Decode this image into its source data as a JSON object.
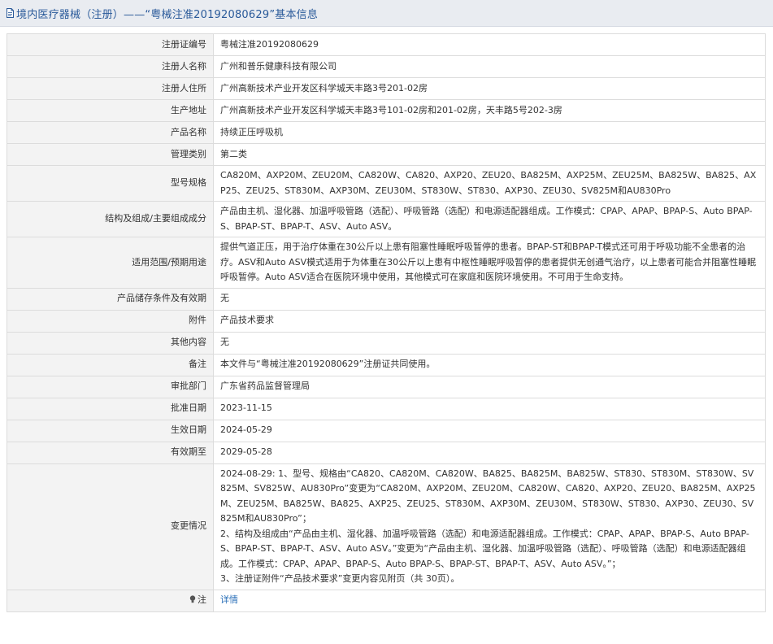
{
  "page": {
    "title": "境内医疗器械（注册）——“粤械注准20192080629”基本信息",
    "title_icon": "document-icon"
  },
  "rows": [
    {
      "label": "注册证编号",
      "value": "粤械注准20192080629"
    },
    {
      "label": "注册人名称",
      "value": "广州和普乐健康科技有限公司"
    },
    {
      "label": "注册人住所",
      "value": "广州高新技术产业开发区科学城天丰路3号201-02房"
    },
    {
      "label": "生产地址",
      "value": "广州高新技术产业开发区科学城天丰路3号101-02房和201-02房，天丰路5号202-3房"
    },
    {
      "label": "产品名称",
      "value": "持续正压呼吸机"
    },
    {
      "label": "管理类别",
      "value": "第二类"
    },
    {
      "label": "型号规格",
      "value": "CA820M、AXP20M、ZEU20M、CA820W、CA820、AXP20、ZEU20、BA825M、AXP25M、ZEU25M、BA825W、BA825、AXP25、ZEU25、ST830M、AXP30M、ZEU30M、ST830W、ST830、AXP30、ZEU30、SV825M和AU830Pro"
    },
    {
      "label": "结构及组成/主要组成成分",
      "value": "产品由主机、湿化器、加温呼吸管路（选配）、呼吸管路（选配）和电源适配器组成。工作模式：CPAP、APAP、BPAP-S、Auto BPAP-S、BPAP-ST、BPAP-T、ASV、Auto ASV。"
    },
    {
      "label": "适用范围/预期用途",
      "value": "提供气道正压，用于治疗体重在30公斤以上患有阻塞性睡眠呼吸暂停的患者。BPAP-ST和BPAP-T模式还可用于呼吸功能不全患者的治疗。ASV和Auto ASV模式适用于为体重在30公斤以上患有中枢性睡眠呼吸暂停的患者提供无创通气治疗，以上患者可能合并阻塞性睡眠呼吸暂停。Auto ASV适合在医院环境中使用，其他模式可在家庭和医院环境使用。不可用于生命支持。"
    },
    {
      "label": "产品储存条件及有效期",
      "value": "无"
    },
    {
      "label": "附件",
      "value": "产品技术要求"
    },
    {
      "label": "其他内容",
      "value": "无"
    },
    {
      "label": "备注",
      "value": "本文件与“粤械注准20192080629”注册证共同使用。"
    },
    {
      "label": "审批部门",
      "value": "广东省药品监督管理局"
    },
    {
      "label": "批准日期",
      "value": "2023-11-15"
    },
    {
      "label": "生效日期",
      "value": "2024-05-29"
    },
    {
      "label": "有效期至",
      "value": "2029-05-28"
    }
  ],
  "change": {
    "label": "变更情况",
    "lines": [
      "2024-08-29: 1、型号、规格由“CA820、CA820M、CA820W、BA825、BA825M、BA825W、ST830、ST830M、ST830W、SV825M、SV825W、AU830Pro”变更为“CA820M、AXP20M、ZEU20M、CA820W、CA820、AXP20、ZEU20、BA825M、AXP25M、ZEU25M、BA825W、BA825、AXP25、ZEU25、ST830M、AXP30M、ZEU30M、ST830W、ST830、AXP30、ZEU30、SV825M和AU830Pro”；",
      "2、结构及组成由“产品由主机、湿化器、加温呼吸管路（选配）和电源适配器组成。工作模式：CPAP、APAP、BPAP-S、Auto BPAP-S、BPAP-ST、BPAP-T、ASV、Auto ASV。”变更为“产品由主机、湿化器、加温呼吸管路（选配）、呼吸管路（选配）和电源适配器组成。工作模式：CPAP、APAP、BPAP-S、Auto BPAP-S、BPAP-ST、BPAP-T、ASV、Auto ASV。”；",
      "3、注册证附件“产品技术要求”变更内容见附页（共 30页）。"
    ]
  },
  "note": {
    "label": "注",
    "icon": "lightbulb-icon",
    "link_text": "详情",
    "link_color": "#2a6fb8"
  },
  "colors": {
    "title_bar_bg": "#e9ecf1",
    "title_text": "#2a5a9a",
    "label_bg": "#f3f3f3",
    "border": "#dcdcdc"
  }
}
